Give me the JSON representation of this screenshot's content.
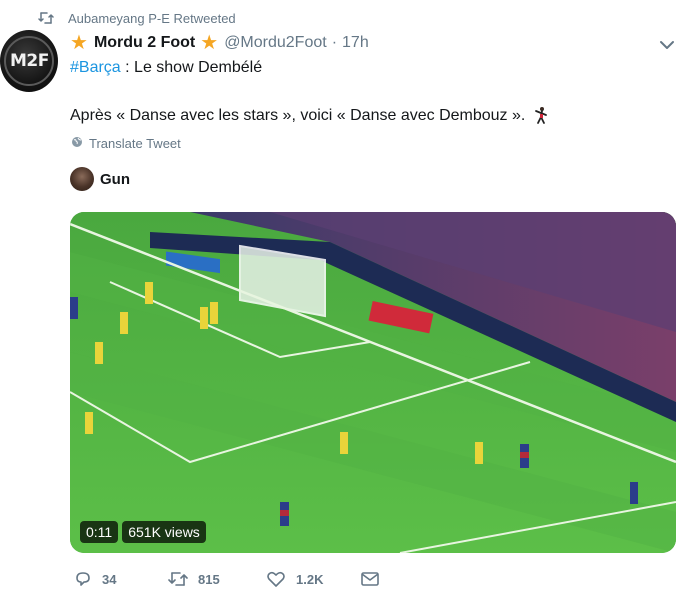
{
  "retweet": {
    "text": "Aubameyang P-E Retweeted"
  },
  "avatar": {
    "initials": "M2F"
  },
  "header": {
    "name": "Mordu 2 Foot",
    "handle": "@Mordu2Foot",
    "separator": "·",
    "time": "17h"
  },
  "tweet": {
    "hashtag": "#Barça",
    "line1_rest": " : Le show Dembélé",
    "line2": "Après « Danse avec les stars », voici « Danse avec Dembouz »."
  },
  "translate": {
    "label": "Translate Tweet"
  },
  "attribution": {
    "name": "Gun"
  },
  "media": {
    "duration": "0:11",
    "views": "651K views"
  },
  "actions": {
    "replies": "34",
    "retweets": "815",
    "likes": "1.2K"
  },
  "colors": {
    "accent": "#1b95e0",
    "muted": "#657786",
    "star": "#f5a623",
    "text": "#14171a"
  },
  "icons": [
    "retweet-icon",
    "star-icon",
    "chevron-down-icon",
    "globe-icon",
    "reply-icon",
    "heart-icon",
    "message-icon",
    "dancer-emoji-icon"
  ]
}
